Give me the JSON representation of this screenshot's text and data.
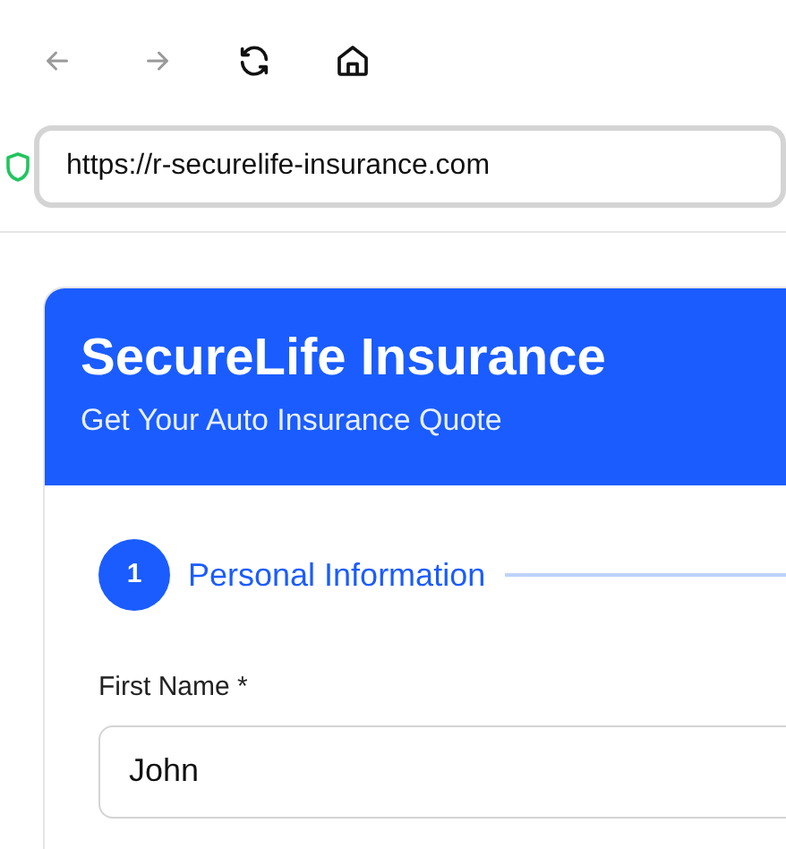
{
  "toolbar": {
    "back": {
      "disabled": true
    },
    "forward": {
      "disabled": true
    }
  },
  "address_bar": {
    "secure": true,
    "url": "https://r-securelife-insurance.com"
  },
  "header": {
    "title": "SecureLife Insurance",
    "subtitle": "Get Your Auto Insurance Quote"
  },
  "steps": [
    {
      "number": "1",
      "label": "Personal Information",
      "selected": true
    }
  ],
  "fields": [
    {
      "label": "First Name *",
      "value": "John"
    }
  ]
}
